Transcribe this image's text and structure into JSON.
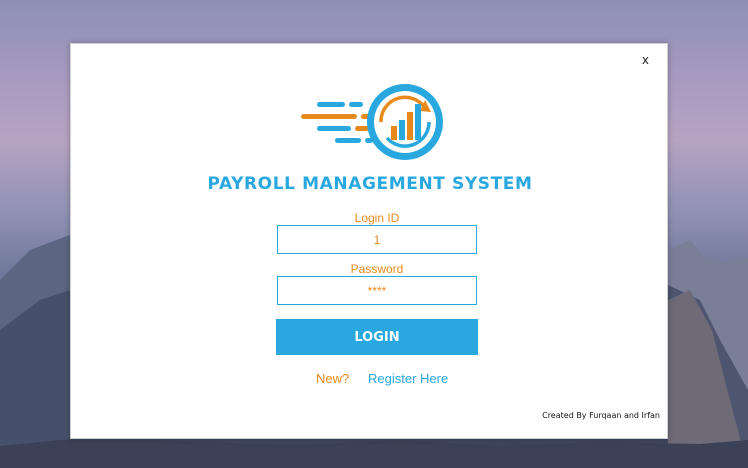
{
  "app": {
    "title": "PAYROLL MANAGEMENT SYSTEM",
    "close_label": "x",
    "logo_icon": "payroll-chart-logo-icon",
    "colors": {
      "accent_blue": "#29a8e0",
      "accent_orange": "#e8891c"
    }
  },
  "form": {
    "login_id_label": "Login ID",
    "login_id_value": "1",
    "password_label": "Password",
    "password_value": "****",
    "login_button_label": "LOGIN"
  },
  "footer": {
    "new_text": "New?",
    "register_label": "Register Here",
    "credit": "Created By Furqaan and Irfan"
  }
}
